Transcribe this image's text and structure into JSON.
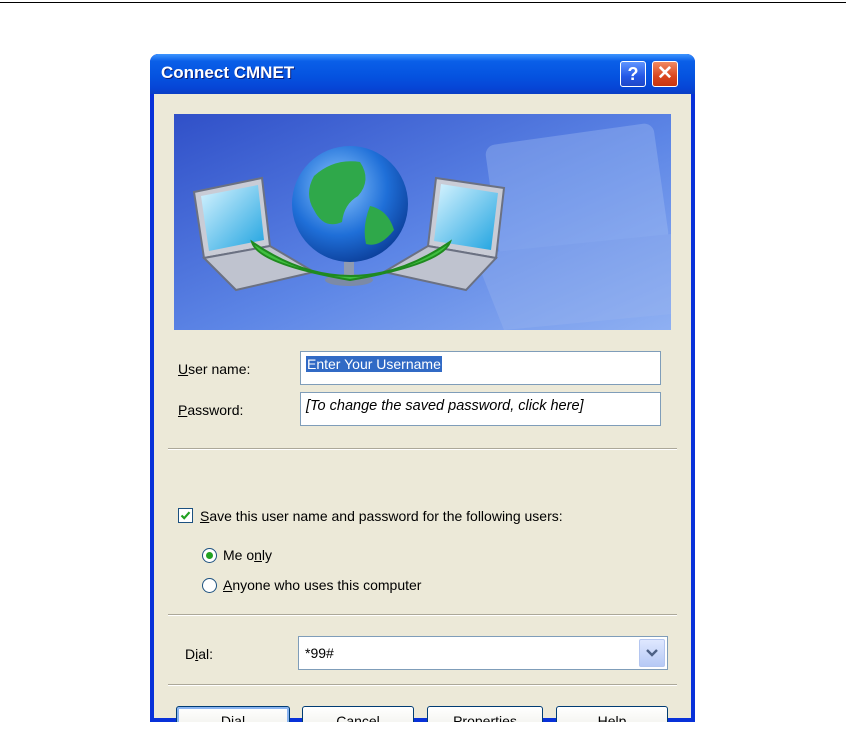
{
  "window": {
    "title": "Connect CMNET",
    "help_glyph": "?",
    "close_glyph": "✕"
  },
  "form": {
    "username_label_access": "U",
    "username_label_rest": "ser name:",
    "username_value": "Enter Your Username",
    "password_label_access": "P",
    "password_label_rest": "assword:",
    "password_value": "[To change the saved password, click here]"
  },
  "save": {
    "checked": true,
    "label_access": "S",
    "label_rest": "ave this user name and password for the following users:",
    "options": [
      {
        "pre": "Me o",
        "access": "n",
        "post": "ly",
        "selected": true
      },
      {
        "pre": "",
        "access": "A",
        "post": "nyone who uses this computer",
        "selected": false
      }
    ]
  },
  "dial": {
    "label_pre": "D",
    "label_access": "i",
    "label_post": "al:",
    "value": "*99#"
  },
  "buttons": {
    "dial": {
      "access": "D",
      "rest": "ial"
    },
    "cancel": "Cancel",
    "properties": {
      "pre": "Pr",
      "access": "o",
      "post": "perties"
    },
    "help": {
      "access": "H",
      "rest": "elp"
    }
  },
  "colors": {
    "titlebar": "#0553e0",
    "face": "#ece9d8",
    "selection": "#316ac5",
    "close": "#d9461f"
  },
  "icons": [
    "help-icon",
    "close-icon",
    "checkmark-icon",
    "dropdown-arrow-icon",
    "globe-icon",
    "laptop-icon"
  ]
}
